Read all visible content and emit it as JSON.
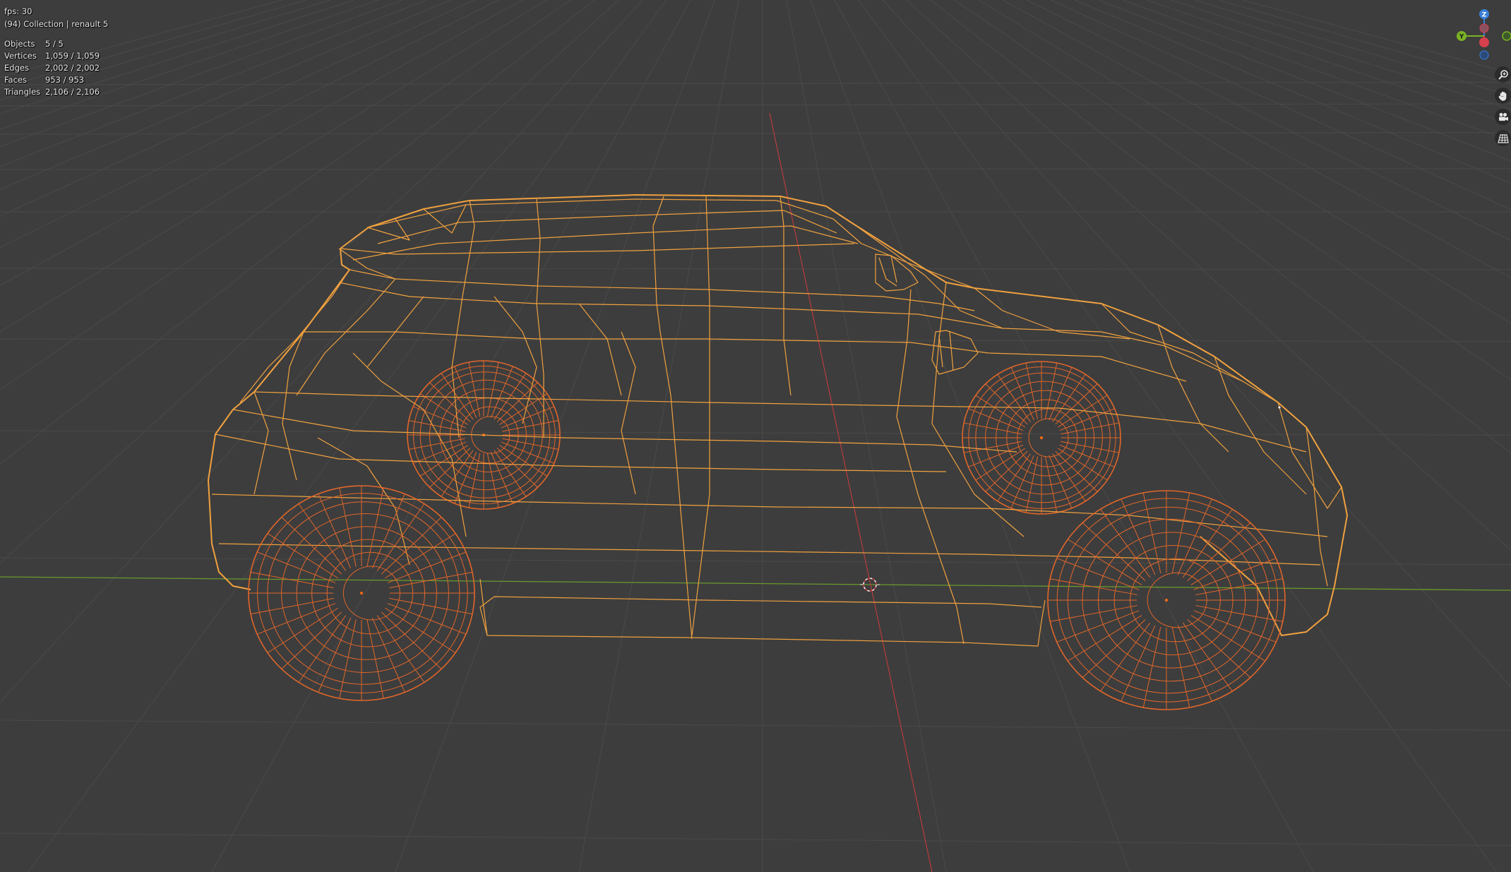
{
  "overlay": {
    "fps": "fps: 30",
    "collection": "(94) Collection | renault 5",
    "stats": [
      {
        "label": "Objects",
        "value": "5 / 5"
      },
      {
        "label": "Vertices",
        "value": "1,059 / 1,059"
      },
      {
        "label": "Edges",
        "value": "2,002 / 2,002"
      },
      {
        "label": "Faces",
        "value": "953 / 953"
      },
      {
        "label": "Triangles",
        "value": "2,106 / 2,106"
      }
    ]
  },
  "gizmo": {
    "z_label": "Z",
    "y_label": "Y",
    "colors": {
      "x": "#d6404c",
      "y": "#7bb324",
      "z": "#3a7fd8"
    }
  },
  "nav_tools": [
    "zoom-icon",
    "hand-pan-icon",
    "camera-icon",
    "grid-ortho-icon"
  ],
  "colors": {
    "background": "#3d3d3d",
    "grid": "#4a4a4a",
    "x_axis": "#b83c3c",
    "y_axis": "#6a9a2c",
    "wire_body": "#f0a13f",
    "wire_wheel": "#e0662a"
  }
}
